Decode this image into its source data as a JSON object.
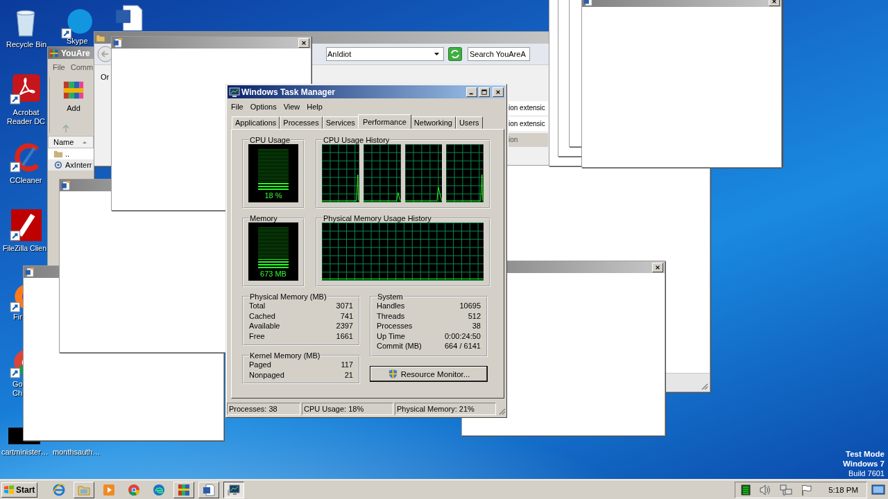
{
  "desktop_icons": [
    {
      "kind": "recycle-bin",
      "label": [
        "Recycle Bin"
      ]
    },
    {
      "kind": "skype",
      "label": [
        "Skype"
      ]
    },
    {
      "kind": "word-doc"
    },
    {
      "kind": "acrobat",
      "label": [
        "Acrobat",
        "Reader DC"
      ]
    },
    {
      "kind": "ccleaner",
      "label": [
        "CCleaner"
      ]
    },
    {
      "kind": "filezilla",
      "label": [
        "FileZilla Clien"
      ]
    },
    {
      "kind": "firefox",
      "label": [
        "Fir"
      ]
    },
    {
      "kind": "chrome",
      "label": [
        "Go",
        "Ch"
      ]
    },
    {
      "kind": "thumbnail",
      "label": [
        "cartminister…"
      ]
    },
    {
      "label": [
        "monthsauth…"
      ]
    }
  ],
  "windows": [
    {
      "kind": "winrar",
      "title": "YouAre",
      "menu": [
        "File",
        "Comm"
      ],
      "toolbar": [
        "Add"
      ],
      "column": "Name",
      "rows": [
        "..",
        "AxInterr"
      ]
    },
    {
      "kind": "explorer",
      "address": "AnIdiot",
      "search_placeholder": "Search YouAreA",
      "toolbar": [
        "Or"
      ],
      "rows": [
        {
          "name": "ion extensic",
          "selected": false
        },
        {
          "name": "ion extensic",
          "selected": false
        },
        {
          "name": "ion",
          "selected": true
        }
      ]
    },
    {
      "kind": "blank"
    },
    {
      "kind": "blank"
    },
    {
      "kind": "blank"
    },
    {
      "kind": "blank"
    },
    {
      "kind": "blank"
    },
    {
      "kind": "blank"
    },
    {
      "kind": "blank"
    },
    {
      "kind": "blank"
    },
    {
      "kind": "blank"
    }
  ],
  "task_manager": {
    "title": "Windows Task Manager",
    "menu": [
      "File",
      "Options",
      "View",
      "Help"
    ],
    "tabs": [
      {
        "label": "Applications",
        "selected": false
      },
      {
        "label": "Processes",
        "selected": false
      },
      {
        "label": "Services",
        "selected": false
      },
      {
        "label": "Performance",
        "selected": true
      },
      {
        "label": "Networking",
        "selected": false
      },
      {
        "label": "Users",
        "selected": false
      }
    ],
    "cpu_usage": {
      "label": "CPU Usage",
      "reading": "18 %",
      "level": 0.18
    },
    "cpu_history": {
      "label": "CPU Usage History"
    },
    "memory": {
      "label": "Memory",
      "reading": "673 MB",
      "level": 0.21
    },
    "memory_history": {
      "label": "Physical Memory Usage History"
    },
    "physical_memory": {
      "label": "Physical Memory (MB)",
      "rows": [
        [
          "Total",
          "3071"
        ],
        [
          "Cached",
          "741"
        ],
        [
          "Available",
          "2397"
        ],
        [
          "Free",
          "1661"
        ]
      ]
    },
    "kernel_memory": {
      "label": "Kernel Memory (MB)",
      "rows": [
        [
          "Paged",
          "117"
        ],
        [
          "Nonpaged",
          "21"
        ]
      ]
    },
    "system": {
      "label": "System",
      "rows": [
        [
          "Handles",
          "10695"
        ],
        [
          "Threads",
          "512"
        ],
        [
          "Processes",
          "38"
        ],
        [
          "Up Time",
          "0:00:24:50"
        ],
        [
          "Commit (MB)",
          "664 / 6141"
        ]
      ]
    },
    "button": "Resource Monitor...",
    "status_bar": [
      "Processes: 38",
      "CPU Usage: 18%",
      "Physical Memory: 21%"
    ]
  },
  "desktop_notice": [
    "Test Mode",
    "Windows 7",
    "Build 7601"
  ],
  "taskbar": {
    "start": "Start",
    "items": [
      {
        "kind": "pinned",
        "selected": false
      },
      {
        "kind": "running",
        "selected": false
      },
      {
        "kind": "pinned",
        "selected": false
      },
      {
        "kind": "pinned",
        "selected": false
      },
      {
        "kind": "pinned",
        "selected": false
      },
      {
        "kind": "running",
        "selected": false
      },
      {
        "kind": "running",
        "selected": false
      },
      {
        "kind": "running",
        "selected": true
      }
    ],
    "clock": "5:18 PM"
  }
}
